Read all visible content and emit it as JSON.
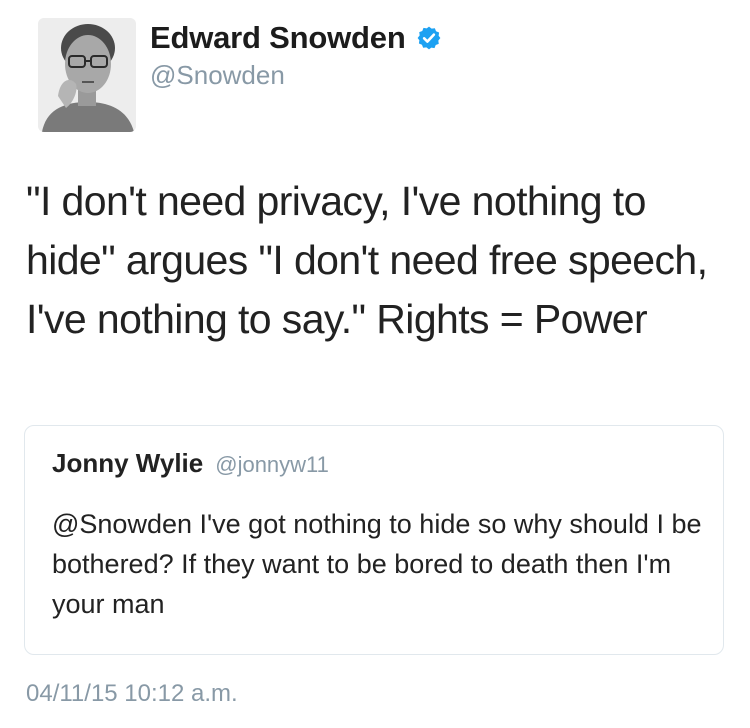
{
  "author": {
    "display_name": "Edward Snowden",
    "handle": "@Snowden",
    "verified": true,
    "avatar": "profile-photo"
  },
  "tweet": {
    "text": "\"I don't need privacy, I've nothing to hide\" argues \"I don't need free speech, I've nothing to say.\" Rights = Power",
    "timestamp": "04/11/15 10:12 a.m."
  },
  "quoted_tweet": {
    "display_name": "Jonny Wylie",
    "handle": "@jonnyw11",
    "text": "@Snowden I've got nothing to hide so why should I be bothered? If they want to be bored to death then I'm your man"
  },
  "colors": {
    "verified_badge": "#1da1f2",
    "secondary_text": "#8899a6",
    "card_border": "#e1e8ed"
  }
}
